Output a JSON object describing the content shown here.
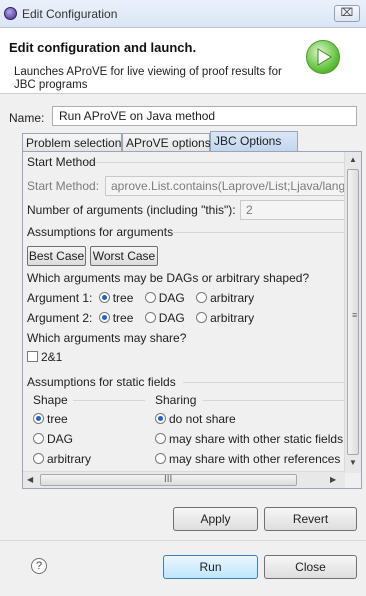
{
  "window": {
    "title": "Edit Configuration",
    "close_glyph": "⌧"
  },
  "header": {
    "title": "Edit configuration and launch.",
    "description": "Launches AProVE for live viewing of proof results for JBC programs"
  },
  "name_field": {
    "label": "Name:",
    "value": "Run AProVE on Java method"
  },
  "tabs": [
    "Problem selection",
    "AProVE options",
    "JBC Options"
  ],
  "active_tab": "JBC Options",
  "start_method": {
    "group_title": "Start Method",
    "label": "Start Method:",
    "value": "aprove.List.contains(Laprove/List;Ljava/lang/O"
  },
  "num_args": {
    "label": "Number of arguments (including \"this\"):",
    "value": "2"
  },
  "assumptions": {
    "group_title": "Assumptions for arguments",
    "best_case": "Best Case",
    "worst_case": "Worst Case",
    "dag_question": "Which arguments may be DAGs or arbitrary shaped?",
    "arguments": [
      {
        "label": "Argument 1:",
        "options": [
          "tree",
          "DAG",
          "arbitrary"
        ],
        "selected": "tree"
      },
      {
        "label": "Argument 2:",
        "options": [
          "tree",
          "DAG",
          "arbitrary"
        ],
        "selected": "tree"
      }
    ],
    "share_question": "Which arguments may share?",
    "share_option": "2&1"
  },
  "static_fields": {
    "group_title": "Assumptions for static fields",
    "shape_title": "Shape",
    "shape_options": [
      "tree",
      "DAG",
      "arbitrary"
    ],
    "shape_selected": "tree",
    "sharing_title": "Sharing",
    "sharing_options": [
      "do not share",
      "may share with other static fields",
      "may share with other references"
    ],
    "sharing_selected": "do not share"
  },
  "buttons": {
    "apply": "Apply",
    "revert": "Revert",
    "run": "Run",
    "close": "Close",
    "help": "?"
  },
  "scrollbar": {
    "grip": "≡",
    "hgrip": "III"
  }
}
